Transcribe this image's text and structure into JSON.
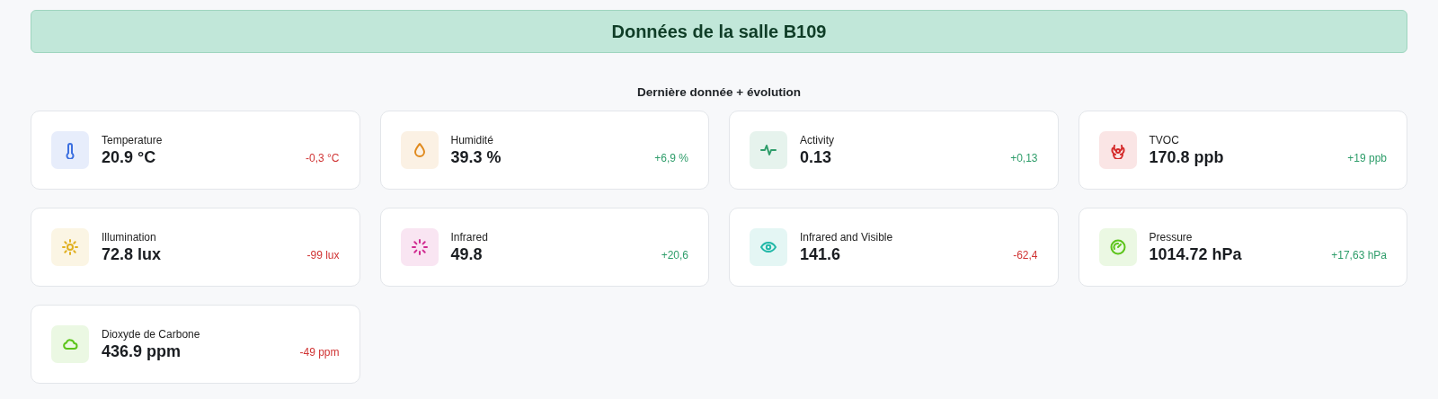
{
  "header": {
    "title": "Données de la salle B109"
  },
  "section": {
    "title": "Dernière donnée + évolution"
  },
  "cards": [
    {
      "kind": "thermometer",
      "color": "#3b6fe0",
      "label": "Temperature",
      "value": "20.9 °C",
      "delta": "-0,3 °C",
      "rising": false
    },
    {
      "kind": "drop",
      "color": "#e08a1e",
      "label": "Humidité",
      "value": "39.3 %",
      "delta": "+6,9 %",
      "rising": true
    },
    {
      "kind": "pulse",
      "color": "#2e9d6a",
      "label": "Activity",
      "value": "0.13",
      "delta": "+0,13",
      "rising": true
    },
    {
      "kind": "biohazard",
      "color": "#d42a2a",
      "label": "TVOC",
      "value": "170.8 ppb",
      "delta": "+19 ppb",
      "rising": true
    },
    {
      "kind": "sun",
      "color": "#e0b020",
      "label": "Illumination",
      "value": "72.8 lux",
      "delta": "-99 lux",
      "rising": false
    },
    {
      "kind": "spinner",
      "color": "#d02a90",
      "label": "Infrared",
      "value": "49.8",
      "delta": "+20,6",
      "rising": true
    },
    {
      "kind": "eye",
      "color": "#22b8a8",
      "label": "Infrared and Visible",
      "value": "141.6",
      "delta": "-62,4",
      "rising": false
    },
    {
      "kind": "gauge",
      "color": "#5cc41a",
      "label": "Pressure",
      "value": "1014.72 hPa",
      "delta": "+17,63 hPa",
      "rising": true
    },
    {
      "kind": "cloud",
      "color": "#5cc41a",
      "label": "Dioxyde de Carbone",
      "value": "436.9 ppm",
      "delta": "-49 ppm",
      "rising": false
    }
  ]
}
